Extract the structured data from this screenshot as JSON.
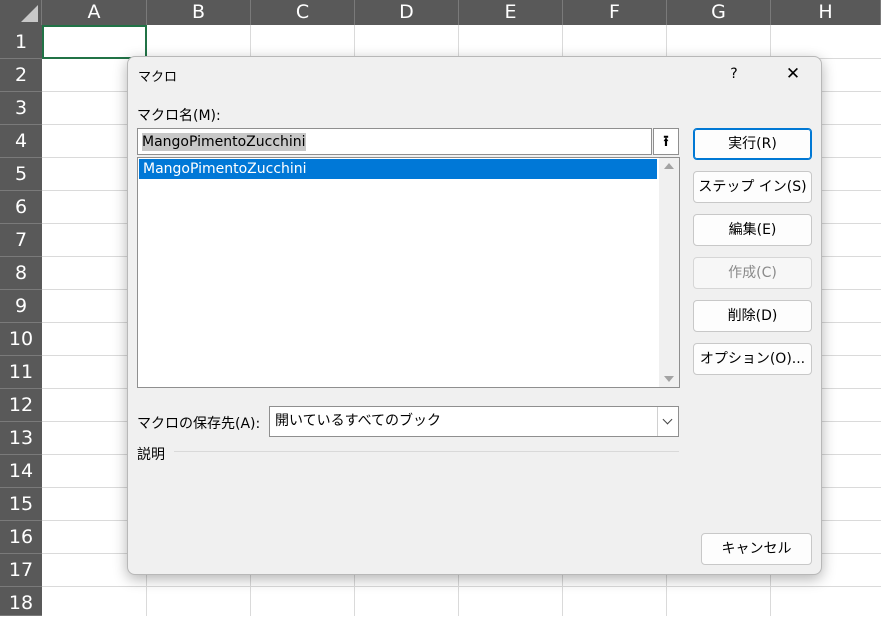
{
  "sheet": {
    "columns": [
      "A",
      "B",
      "C",
      "D",
      "E",
      "F",
      "G",
      "H"
    ],
    "rows": [
      "1",
      "2",
      "3",
      "4",
      "5",
      "6",
      "7",
      "8",
      "9",
      "10",
      "11",
      "12",
      "13",
      "14",
      "15",
      "16",
      "17",
      "18"
    ]
  },
  "dialog": {
    "title": "マクロ",
    "help": "?",
    "close": "✕",
    "macro_name_label": "マクロ名(M):",
    "macro_name_value": "MangoPimentoZucchini",
    "up_icon": "⭱",
    "macro_list": [
      "MangoPimentoZucchini"
    ],
    "buttons": {
      "run": "実行(R)",
      "step_in": "ステップ イン(S)",
      "edit": "編集(E)",
      "create": "作成(C)",
      "delete": "削除(D)",
      "options": "オプション(O)...",
      "cancel": "キャンセル"
    },
    "location_label": "マクロの保存先(A):",
    "location_value": "開いているすべてのブック",
    "description_label": "説明"
  },
  "colors": {
    "header_bg": "#595959",
    "selection": "#0078d7",
    "active_cell_border": "#217346",
    "primary_button_border": "#0078d4"
  }
}
